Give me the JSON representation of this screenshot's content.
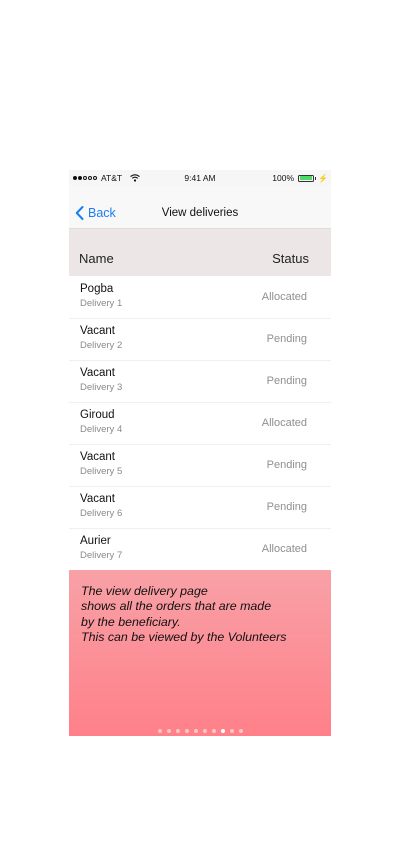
{
  "status_bar": {
    "carrier": "AT&T",
    "time": "9:41 AM",
    "battery": "100%",
    "signal_bars": 2,
    "signal_total": 5,
    "battery_color": "#4cd964"
  },
  "nav": {
    "back_label": "Back",
    "title": "View deliveries",
    "accent_color": "#1a7ef2"
  },
  "table": {
    "headers": {
      "name": "Name",
      "status": "Status"
    },
    "rows": [
      {
        "name": "Pogba",
        "sub": "Delivery 1",
        "status": "Allocated"
      },
      {
        "name": "Vacant",
        "sub": "Delivery 2",
        "status": "Pending"
      },
      {
        "name": "Vacant",
        "sub": "Delivery 3",
        "status": "Pending"
      },
      {
        "name": "Giroud",
        "sub": "Delivery 4",
        "status": "Allocated"
      },
      {
        "name": "Vacant",
        "sub": "Delivery 5",
        "status": "Pending"
      },
      {
        "name": "Vacant",
        "sub": "Delivery 6",
        "status": "Pending"
      },
      {
        "name": "Aurier",
        "sub": "Delivery 7",
        "status": "Allocated"
      }
    ]
  },
  "caption": {
    "text": "The view delivery page\n shows all the orders that are made\nby the beneficiary.\nThis can be viewed by the Volunteers"
  },
  "pager": {
    "total": 10,
    "active_index": 7
  }
}
